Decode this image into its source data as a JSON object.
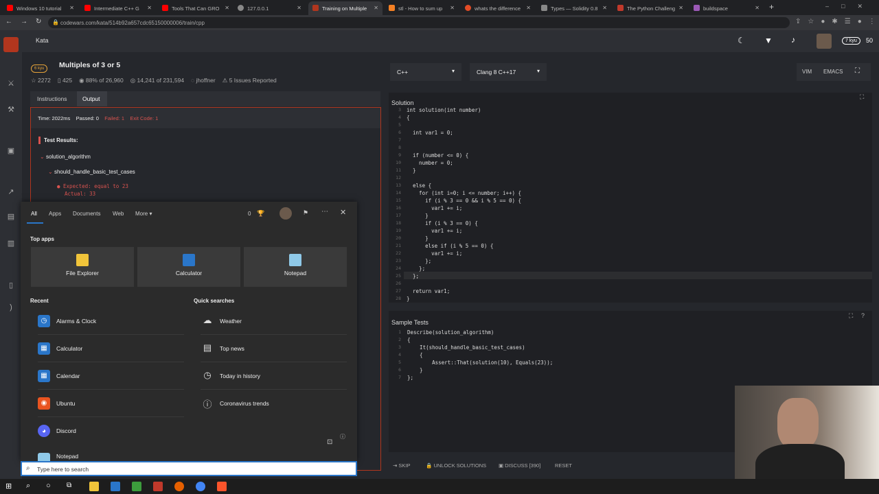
{
  "browser": {
    "tabs": [
      {
        "label": "Windows 10 tutorial",
        "color": "#ff0000"
      },
      {
        "label": "Intermediate C++ G",
        "color": "#ff0000"
      },
      {
        "label": "Tools That Can GRO",
        "color": "#ff0000"
      },
      {
        "label": "127.0.0.1",
        "color": "#888888"
      },
      {
        "label": "Training on Multiple",
        "color": "#b1361e"
      },
      {
        "label": "stl - How to sum up",
        "color": "#f48024"
      },
      {
        "label": "whats the difference",
        "color": "#e34c26"
      },
      {
        "label": "Types — Solidity 0.8",
        "color": "#888888"
      },
      {
        "label": "The Python Challeng",
        "color": "#c0392b"
      },
      {
        "label": "buildspace",
        "color": "#9b59b6"
      }
    ],
    "new_tab": "+",
    "url": "codewars.com/kata/514b92a657cdc65150000006/train/cpp"
  },
  "cw": {
    "section": "Kata",
    "rank": "7 kyu",
    "stars": "50",
    "kata": {
      "kyu": "6 kyu",
      "title": "Multiples of 3 or 5",
      "stats": [
        "2272",
        "425",
        "88% of 26,960",
        "14,241 of 231,594",
        "jhoffner",
        "5 Issues Reported"
      ]
    },
    "tabs": {
      "instructions": "Instructions",
      "output": "Output"
    },
    "output": {
      "time": "Time: 2022ms",
      "passed": "Passed: 0",
      "failed": "Failed: 1",
      "exit": "Exit Code: 1",
      "results": "Test Results:",
      "describe": "solution_algorithm",
      "it": "should_handle_basic_test_cases",
      "expected": "Expected: equal to 23",
      "actual": "Actual: 33"
    },
    "lang": "C++",
    "compiler": "Clang 8 C++17",
    "vim": "VIM",
    "emacs": "EMACS",
    "solution_title": "Solution",
    "solution_lines": [
      "3",
      "4",
      "5",
      "6",
      "7",
      "8",
      "9",
      "10",
      "11",
      "12",
      "13",
      "14",
      "15",
      "16",
      "17",
      "18",
      "19",
      "20",
      "21",
      "22",
      "23",
      "24",
      "25",
      "26",
      "27",
      "28"
    ],
    "solution_code": "int solution(int number)\n{\n\n  int var1 = 0;\n\n\n  if (number <= 0) {\n    number = 0;\n  }\n\n  else {\n    for (int i=0; i <= number; i++) {\n      if (i % 3 == 0 && i % 5 == 0) {\n        var1 += i;\n      }\n      if (i % 3 == 0) {\n        var1 += i;\n      }\n      else if (i % 5 == 0) {\n        var1 += i;\n      };\n    };\n  };\n\n  return var1;\n}",
    "tests_title": "Sample Tests",
    "tests_lines": [
      "1",
      "2",
      "3",
      "4",
      "5",
      "6",
      "7"
    ],
    "tests_code": "Describe(solution_algorithm)\n{\n    It(should_handle_basic_test_cases)\n    {\n        Assert::That(solution(10), Equals(23));\n    }\n};",
    "buttons": {
      "skip": "SKIP",
      "unlock": "UNLOCK SOLUTIONS",
      "discuss": "DISCUSS [390]",
      "reset": "RESET"
    }
  },
  "start": {
    "tabs": [
      "All",
      "Apps",
      "Documents",
      "Web",
      "More"
    ],
    "points": "0",
    "top_apps_label": "Top apps",
    "top_apps": [
      {
        "label": "File Explorer",
        "color": "#f0c43a"
      },
      {
        "label": "Calculator",
        "color": "#2a76c9"
      },
      {
        "label": "Notepad",
        "color": "#8fc9e8"
      }
    ],
    "recent_label": "Recent",
    "recent": [
      {
        "label": "Alarms & Clock",
        "color": "#2a76c9"
      },
      {
        "label": "Calculator",
        "color": "#2a76c9"
      },
      {
        "label": "Calendar",
        "color": "#2a76c9"
      },
      {
        "label": "Ubuntu",
        "color": "#e95420"
      },
      {
        "label": "Discord",
        "color": "#5865f2"
      },
      {
        "label": "Notepad",
        "color": "#8fc9e8"
      }
    ],
    "quick_label": "Quick searches",
    "quick": [
      {
        "label": "Weather",
        "icon": "weather-icon"
      },
      {
        "label": "Top news",
        "icon": "news-icon"
      },
      {
        "label": "Today in history",
        "icon": "clock-icon"
      },
      {
        "label": "Coronavirus trends",
        "icon": "info-icon"
      }
    ],
    "search_placeholder": "Type here to search"
  }
}
